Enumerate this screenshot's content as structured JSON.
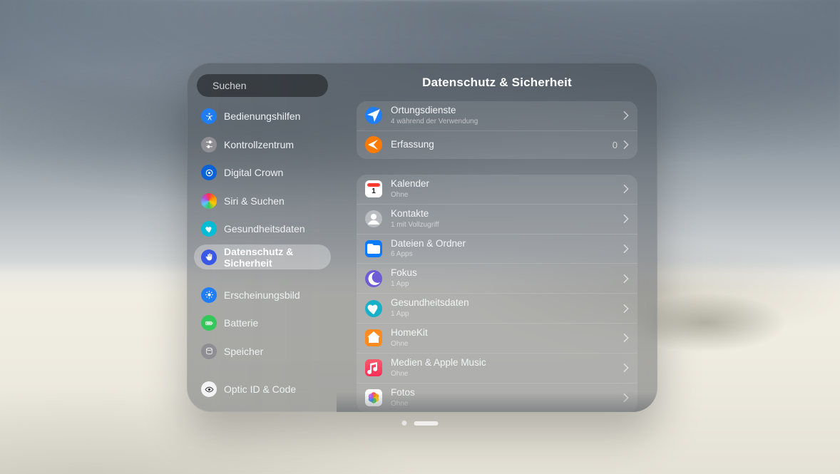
{
  "search": {
    "placeholder": "Suchen"
  },
  "sidebar": {
    "items": [
      {
        "label": "Bedienungshilfen"
      },
      {
        "label": "Kontrollzentrum"
      },
      {
        "label": "Digital Crown"
      },
      {
        "label": "Siri & Suchen"
      },
      {
        "label": "Gesundheitsdaten"
      },
      {
        "label": "Datenschutz & Sicherheit"
      },
      {
        "label": "Erscheinungsbild"
      },
      {
        "label": "Batterie"
      },
      {
        "label": "Speicher"
      },
      {
        "label": "Optic ID & Code"
      }
    ],
    "selected_index": 5
  },
  "content": {
    "title": "Datenschutz & Sicherheit",
    "group1": [
      {
        "title": "Ortungsdienste",
        "subtitle": "4 während der Verwendung"
      },
      {
        "title": "Erfassung",
        "badge": "0"
      }
    ],
    "group2": [
      {
        "title": "Kalender",
        "subtitle": "Ohne"
      },
      {
        "title": "Kontakte",
        "subtitle": "1 mit Vollzugriff"
      },
      {
        "title": "Dateien & Ordner",
        "subtitle": "6 Apps"
      },
      {
        "title": "Fokus",
        "subtitle": "1 App"
      },
      {
        "title": "Gesundheitsdaten",
        "subtitle": "1 App"
      },
      {
        "title": "HomeKit",
        "subtitle": "Ohne"
      },
      {
        "title": "Medien & Apple Music",
        "subtitle": "Ohne"
      },
      {
        "title": "Fotos",
        "subtitle": "Ohne"
      }
    ]
  }
}
